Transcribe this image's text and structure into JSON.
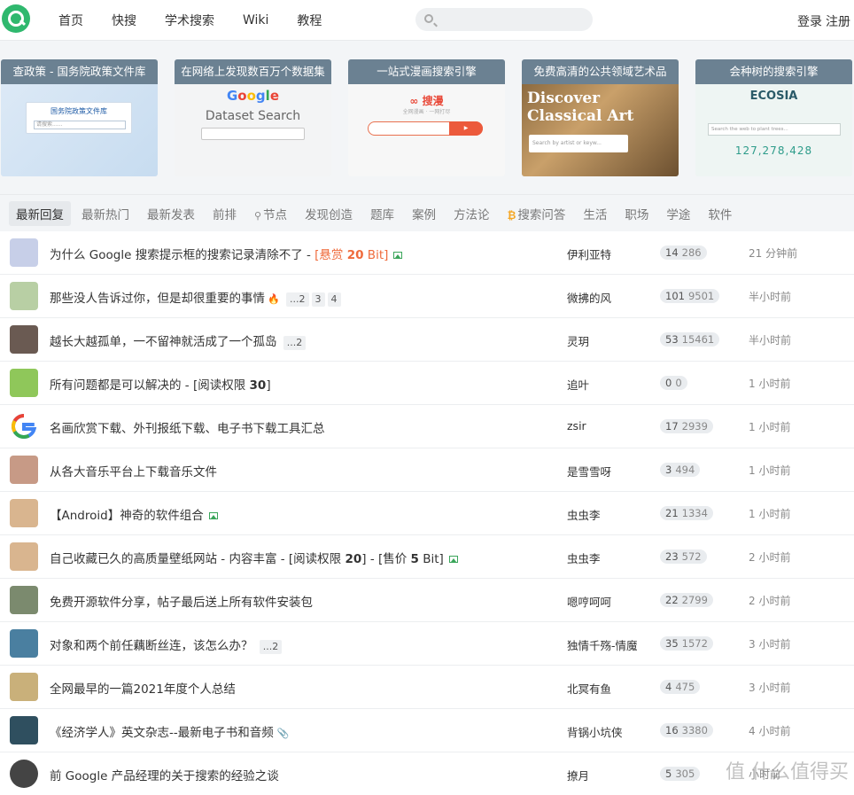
{
  "header": {
    "nav": [
      "首页",
      "快搜",
      "学术搜索",
      "Wiki",
      "教程"
    ],
    "login": "登录",
    "register": "注册"
  },
  "banners": [
    {
      "title": "查政策 - 国务院政策文件库",
      "inner": "国务院政策文件库",
      "placeholder": "请搜索......"
    },
    {
      "title": "在网络上发现数百万个数据集",
      "logo": "Google",
      "sub": "Dataset Search"
    },
    {
      "title": "一站式漫画搜索引擎",
      "logo": "搜漫",
      "tagline": "全网漫画 · 一网打尽"
    },
    {
      "title": "免费高清的公共领域艺术品",
      "big1": "Discover",
      "big2": "Classical Art",
      "placeholder": "Search by artist or keyw..."
    },
    {
      "title": "会种树的搜索引擎",
      "logo": "ECOSIA",
      "placeholder": "Search the web to plant trees...",
      "count": "127,278,428"
    }
  ],
  "tabs": [
    {
      "label": "最新回复",
      "active": true
    },
    {
      "label": "最新热门"
    },
    {
      "label": "最新发表"
    },
    {
      "label": "前排"
    },
    {
      "label": "节点",
      "icon": "node-icon"
    },
    {
      "label": "发现创造"
    },
    {
      "label": "题库"
    },
    {
      "label": "案例"
    },
    {
      "label": "方法论"
    },
    {
      "label": "搜索问答",
      "icon": "bitcoin-icon"
    },
    {
      "label": "生活"
    },
    {
      "label": "职场"
    },
    {
      "label": "学途"
    },
    {
      "label": "软件"
    }
  ],
  "topics": [
    {
      "title": "为什么 Google 搜索提示框的搜索记录清除不了 - ",
      "bounty_pre": "[悬赏 ",
      "bounty_num": "20",
      "bounty_post": " Bit]",
      "author": "伊利亚特",
      "replies": "14",
      "views": "286",
      "time": "21 分钟前",
      "avatar_color": "#c7cfe8"
    },
    {
      "title": "那些没人告诉过你，但是却很重要的事情",
      "pages": [
        "...2",
        "3",
        "4"
      ],
      "author": "微拂的风",
      "replies": "101",
      "views": "9501",
      "time": "半小时前",
      "avatar_color": "#b8cfa4"
    },
    {
      "title": "越长大越孤单，一不留神就活成了一个孤岛",
      "pages": [
        "...2"
      ],
      "author": "灵玥",
      "replies": "53",
      "views": "15461",
      "time": "半小时前",
      "avatar_color": "#6a5a52"
    },
    {
      "title": "所有问题都是可以解决的 - [阅读权限 ",
      "bold": "30",
      "title_post": "]",
      "author": "追叶",
      "replies": "0",
      "views": "0",
      "time": "1 小时前",
      "avatar_color": "#8fc75a"
    },
    {
      "title": "名画欣赏下载、外刊报纸下载、电子书下载工具汇总",
      "author": "zsir",
      "replies": "17",
      "views": "2939",
      "time": "1 小时前",
      "avatar_color": "#ffffff"
    },
    {
      "title": "从各大音乐平台上下载音乐文件",
      "author": "是雪雪呀",
      "replies": "3",
      "views": "494",
      "time": "1 小时前",
      "avatar_color": "#c79a86"
    },
    {
      "title": "【Android】神奇的软件组合",
      "author": "虫虫李",
      "replies": "21",
      "views": "1334",
      "time": "1 小时前",
      "avatar_color": "#d9b58f"
    },
    {
      "title": "自己收藏已久的高质量壁纸网站 - 内容丰富 - [阅读权限 ",
      "bold": "20",
      "title_post": "] - [售价 ",
      "bold2": "5",
      "title_post2": " Bit]",
      "author": "虫虫李",
      "replies": "23",
      "views": "572",
      "time": "2 小时前",
      "avatar_color": "#d9b58f"
    },
    {
      "title": "免费开源软件分享，帖子最后送上所有软件安装包",
      "author": "嗯哼呵呵",
      "replies": "22",
      "views": "2799",
      "time": "2 小时前",
      "avatar_color": "#7b8a6e"
    },
    {
      "title": "对象和两个前任藕断丝连，该怎么办？",
      "pages": [
        "...2"
      ],
      "author": "独情千殇-情魔",
      "replies": "35",
      "views": "1572",
      "time": "3 小时前",
      "avatar_color": "#4a7fa0"
    },
    {
      "title": "全网最早的一篇2021年度个人总结",
      "author": "北冥有鱼",
      "replies": "4",
      "views": "475",
      "time": "3 小时前",
      "avatar_color": "#c9b07a"
    },
    {
      "title": "《经济学人》英文杂志--最新电子书和音频",
      "author": "背锅小坑侠",
      "replies": "16",
      "views": "3380",
      "time": "4 小时前",
      "avatar_color": "#2f4f5f"
    },
    {
      "title": "前 Google 产品经理的关于搜索的经验之谈",
      "author": "撩月",
      "replies": "5",
      "views": "305",
      "time": "小时前",
      "avatar_color": "#444444"
    }
  ],
  "watermark": "值 什么值得买"
}
